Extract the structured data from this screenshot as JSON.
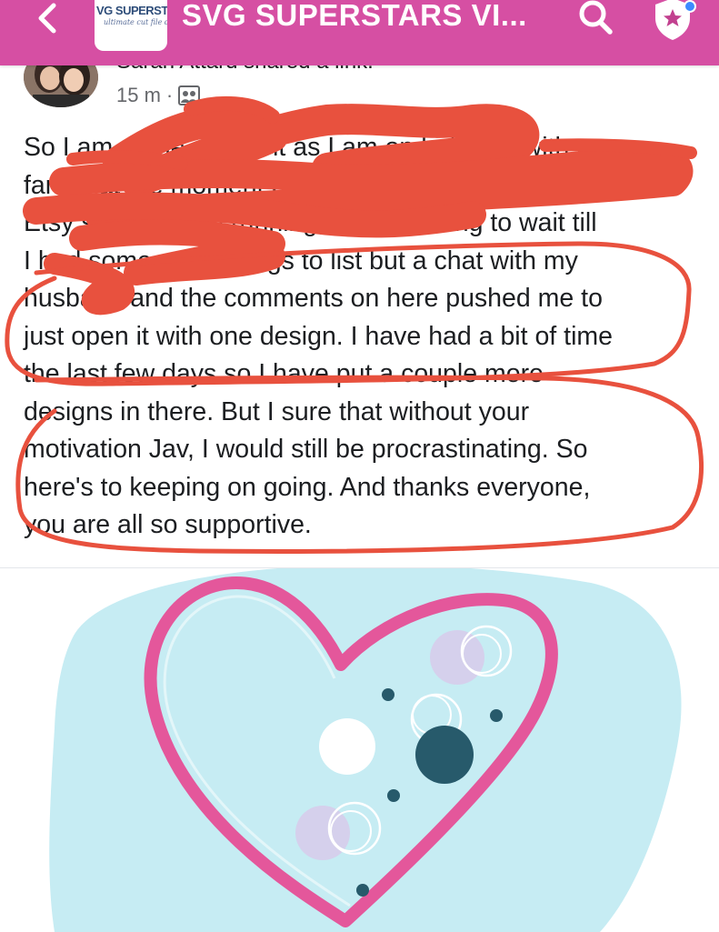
{
  "header": {
    "group_title": "SVG SUPERSTARS VI...",
    "group_logo_text": "VG SUPERST",
    "group_logo_subtext": "ultimate cut file designing",
    "background_color": "#d64fa3",
    "icons": {
      "back": "chevron-left-icon",
      "search": "search-icon",
      "badge": "shield-star-icon"
    }
  },
  "post": {
    "author_line": "Sarah Attard shared a link.",
    "timestamp": "15 m",
    "separator": "·",
    "audience_icon": "group-audience-icon",
    "text_lines": [
      "So I am at the moment as I am on holidays with my",
      "family at the moment but decided to open my",
      "Etsy shop up and running, was planning to wait till",
      "I had some more things to list but a chat with my",
      "husband and the comments on here pushed me to",
      "just open it with one design. I have had a bit of time",
      "the last few days so I have put a couple more",
      "designs in there. But I sure that without your",
      "motivation Jav, I would still be procrastinating. So",
      "here's to keeping on going. And thanks everyone,",
      "you are all so supportive."
    ]
  },
  "annotation_color": "#e8513e",
  "shared_image": {
    "description_icon": "heart-artwork-image",
    "colors": {
      "blob": "#c6ecf3",
      "heart": "#e4579b",
      "dark_dot": "#275a6b",
      "light_circle": "#d8c9ea"
    }
  }
}
